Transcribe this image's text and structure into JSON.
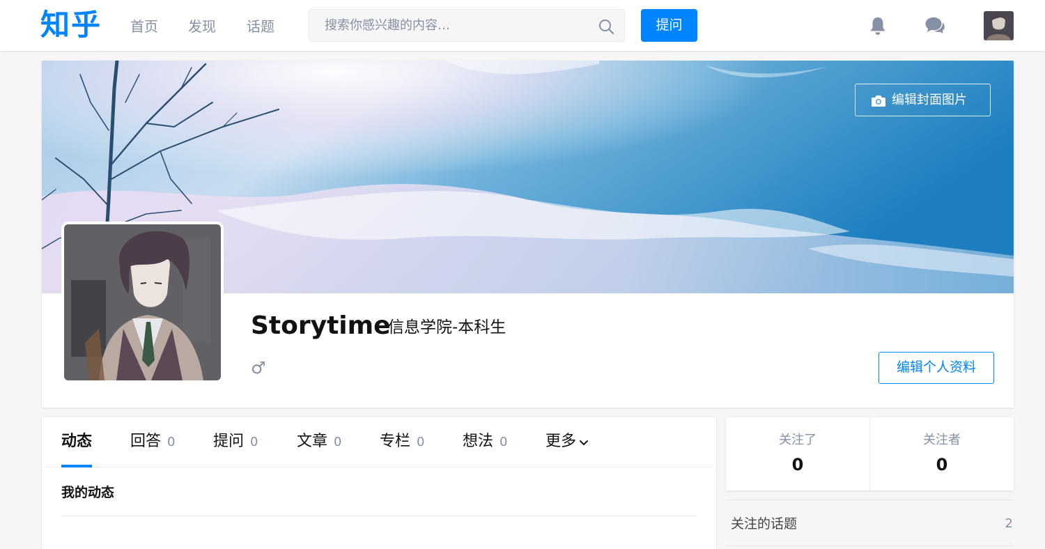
{
  "colors": {
    "brand": "#0084ff",
    "muted": "#8590a6",
    "text": "#121212",
    "page_bg": "#f6f6f6"
  },
  "header": {
    "logo": "知乎",
    "nav": [
      {
        "label": "首页"
      },
      {
        "label": "发现"
      },
      {
        "label": "话题"
      }
    ],
    "search": {
      "placeholder": "搜索你感兴趣的内容…",
      "value": "",
      "icon": "search-icon"
    },
    "ask_button": "提问",
    "icons": [
      "bell-icon",
      "chat-bubbles-icon",
      "user-avatar"
    ]
  },
  "profile": {
    "cover_button": "编辑封面图片",
    "cover_button_icon": "camera-icon",
    "name": "Storytime",
    "headline": "信息学院-本科生",
    "gender_symbol": "♂",
    "edit_button": "编辑个人资料"
  },
  "tabs": [
    {
      "label": "动态",
      "count": "",
      "active": true
    },
    {
      "label": "回答",
      "count": "0"
    },
    {
      "label": "提问",
      "count": "0"
    },
    {
      "label": "文章",
      "count": "0"
    },
    {
      "label": "专栏",
      "count": "0"
    },
    {
      "label": "想法",
      "count": "0"
    },
    {
      "label": "更多",
      "count": "",
      "icon": "chevron-down-icon"
    }
  ],
  "feed": {
    "title": "我的动态"
  },
  "sidebar": {
    "following": {
      "label": "关注了",
      "value": "0"
    },
    "followers": {
      "label": "关注者",
      "value": "0"
    },
    "topics": {
      "label": "关注的话题",
      "count": "2"
    }
  }
}
